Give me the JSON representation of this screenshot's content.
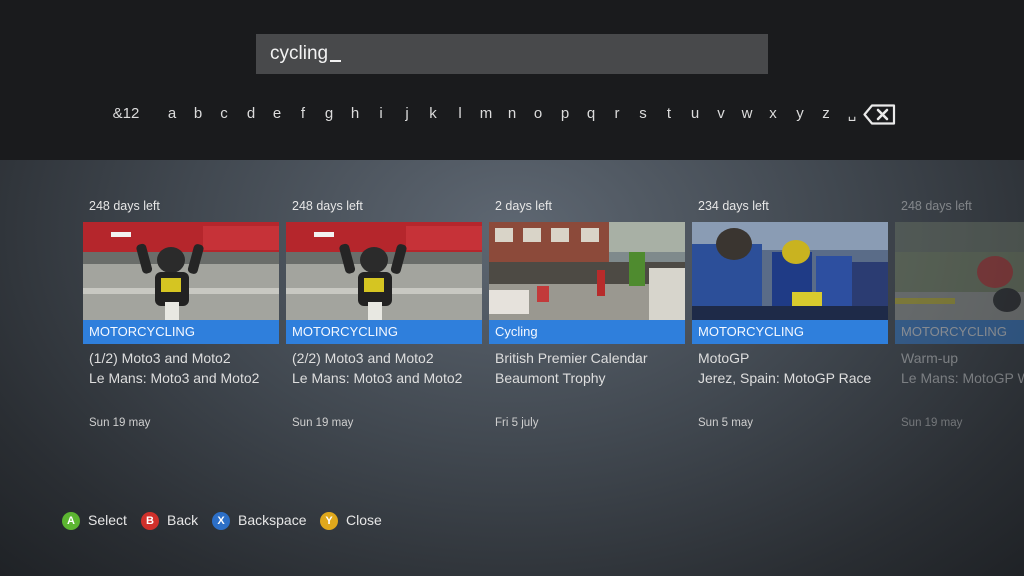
{
  "search": {
    "query": "cycling"
  },
  "keyboard": {
    "keys": [
      "&12",
      "a",
      "b",
      "c",
      "d",
      "e",
      "f",
      "g",
      "h",
      "i",
      "j",
      "k",
      "l",
      "m",
      "n",
      "o",
      "p",
      "q",
      "r",
      "s",
      "t",
      "u",
      "v",
      "w",
      "x",
      "y",
      "z",
      "␣"
    ],
    "backspace_icon": "backspace-icon"
  },
  "results": [
    {
      "days_left": "248 days left",
      "category": "MOTORCYCLING",
      "title": "(1/2) Moto3 and Moto2",
      "subtitle": "Le Mans: Moto3 and Moto2",
      "date": "Sun 19 may"
    },
    {
      "days_left": "248 days left",
      "category": "MOTORCYCLING",
      "title": "(2/2) Moto3 and Moto2",
      "subtitle": "Le Mans: Moto3 and Moto2",
      "date": "Sun 19 may"
    },
    {
      "days_left": "2 days left",
      "category": "Cycling",
      "title": "British Premier Calendar",
      "subtitle": "Beaumont Trophy",
      "date": "Fri 5 july"
    },
    {
      "days_left": "234 days left",
      "category": "MOTORCYCLING",
      "title": "MotoGP",
      "subtitle": "Jerez, Spain: MotoGP Race",
      "date": "Sun 5 may"
    },
    {
      "days_left": "248 days left",
      "category": "MOTORCYCLING",
      "title": "Warm-up",
      "subtitle": "Le Mans: MotoGP W",
      "date": "Sun 19 may"
    }
  ],
  "legend": [
    {
      "button": "A",
      "label": "Select",
      "color": "#5cb531"
    },
    {
      "button": "B",
      "label": "Back",
      "color": "#d0302b"
    },
    {
      "button": "X",
      "label": "Backspace",
      "color": "#2c6fc7"
    },
    {
      "button": "Y",
      "label": "Close",
      "color": "#e0a81c"
    }
  ]
}
